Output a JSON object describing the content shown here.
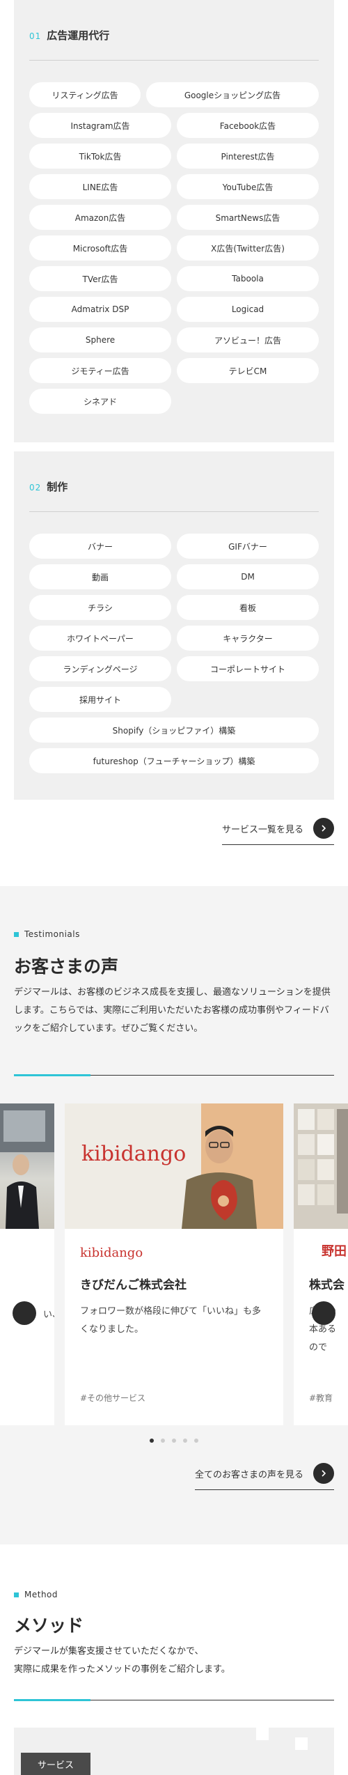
{
  "ads": {
    "num": "01",
    "title": "広告運用代行",
    "items": [
      "リスティング広告",
      "Googleショッピング広告",
      "Instagram広告",
      "Facebook広告",
      "TikTok広告",
      "Pinterest広告",
      "LINE広告",
      "YouTube広告",
      "Amazon広告",
      "SmartNews広告",
      "Microsoft広告",
      "X広告(Twitter広告)",
      "TVer広告",
      "Taboola",
      "Admatrix DSP",
      "Logicad",
      "Sphere",
      "アソビュー！広告",
      "ジモティー広告",
      "テレビCM",
      "シネアド"
    ]
  },
  "production": {
    "num": "02",
    "title": "制作",
    "items": [
      "バナー",
      "GIFバナー",
      "動画",
      "DM",
      "チラシ",
      "看板",
      "ホワイトペーパー",
      "キャラクター",
      "ランディングページ",
      "コーポレートサイト",
      "採用サイト",
      "Shopify（ショッピファイ）構築",
      "futureshop（フューチャーショップ）構築"
    ]
  },
  "services_link": {
    "label": "サービス一覧を見る",
    "icon": "arrow-right-icon"
  },
  "testimonials": {
    "tag": "Testimonials",
    "title": "お客さまの声",
    "description": "デジマールは、お客様のビジネス成長を支援し、最適なソリューションを提供します。こちらでは、実際にご利用いただいたお客様の成功事例やフィードバックをご紹介しています。ぜひご覧ください。",
    "cards": [
      {
        "company": "株式会",
        "logo_text": "野田",
        "text": "広告の本あるので",
        "tag": "#教育"
      },
      {
        "company": "きびだんご株式会社",
        "logo_text": "kibidango",
        "photo_text": "kibidango",
        "text": "フォロワー数が格段に伸びて「いいね」も多くなりました。",
        "tag": "#その他サービス"
      },
      {
        "text": "い、"
      }
    ],
    "pagination": {
      "count": 5,
      "active": 0
    },
    "all_link": {
      "label": "全てのお客さまの声を見る",
      "icon": "arrow-right-icon"
    }
  },
  "method": {
    "tag": "Method",
    "title": "メソッド",
    "description_lines": [
      "デジマールが集客支援させていただくなかで、",
      "実際に成果を作ったメソッドの事例をご紹介します。"
    ],
    "card_badge": "サービス"
  },
  "colors": {
    "accent": "#2ec4d6",
    "brand_red": "#c8332f",
    "dark": "#2b2b2b",
    "panel": "#f0f0f0"
  }
}
